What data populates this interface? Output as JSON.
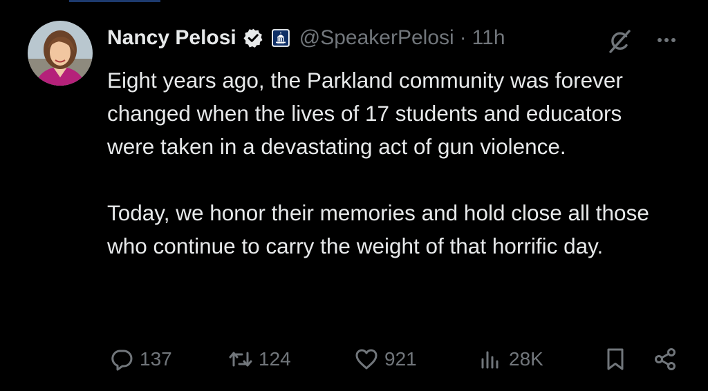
{
  "tweet": {
    "author_name": "Nancy Pelosi",
    "handle": "@SpeakerPelosi",
    "separator": "·",
    "time": "11h",
    "paragraphs": [
      "Eight years ago, the Parkland community was forever changed when the lives of 17 students and educators were taken in a devastating act of gun violence.",
      "Today, we honor their memories and hold close all those who continue to carry the weight of that horrific day."
    ]
  },
  "actions": {
    "replies": "137",
    "reposts": "124",
    "likes": "921",
    "views": "28K"
  },
  "icons": {
    "verified": "verified-badge-icon",
    "affiliation": "capitol-affiliation-icon",
    "grok": "grok-icon",
    "more": "more-icon",
    "reply": "reply-icon",
    "repost": "repost-icon",
    "like": "heart-icon",
    "views": "views-icon",
    "bookmark": "bookmark-icon",
    "share": "share-icon"
  },
  "colors": {
    "background": "#000000",
    "text": "#e7e9ea",
    "secondary": "#71767b",
    "verified_blue": "#1d9bf0"
  }
}
